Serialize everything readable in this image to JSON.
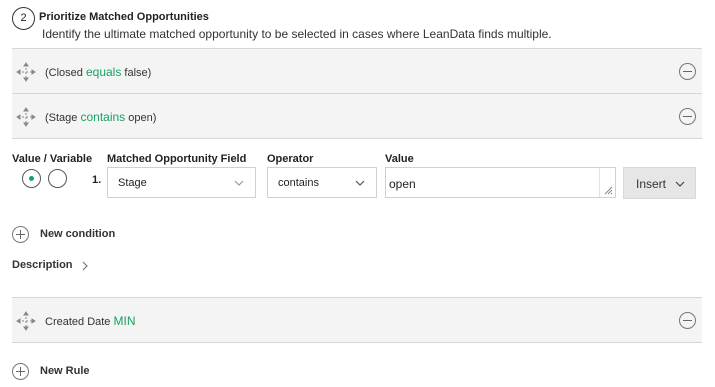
{
  "section": {
    "step_number": "2",
    "title": "Prioritize Matched Opportunities",
    "subtitle": "Identify the ultimate matched opportunity to be selected in cases where LeanData finds multiple."
  },
  "rules": [
    {
      "open": "(Closed ",
      "keyword": "equals",
      "rest": " false)"
    },
    {
      "open": "(Stage ",
      "keyword": "contains",
      "rest": " open)"
    },
    {
      "open": "Created Date ",
      "keyword": "MIN",
      "rest": ""
    }
  ],
  "condition_editor": {
    "headers": {
      "value_variable": "Value / Variable",
      "field": "Matched Opportunity Field",
      "operator": "Operator",
      "value": "Value"
    },
    "row_number": "1.",
    "field_selected": "Stage",
    "operator_selected": "contains",
    "value": "open",
    "insert_label": "Insert"
  },
  "new_condition_label": "New condition",
  "description_label": "Description",
  "new_rule_label": "New Rule",
  "colors": {
    "accent": "#1aa163",
    "row_bg": "#f4f4f4",
    "border": "#d6d6d6"
  }
}
